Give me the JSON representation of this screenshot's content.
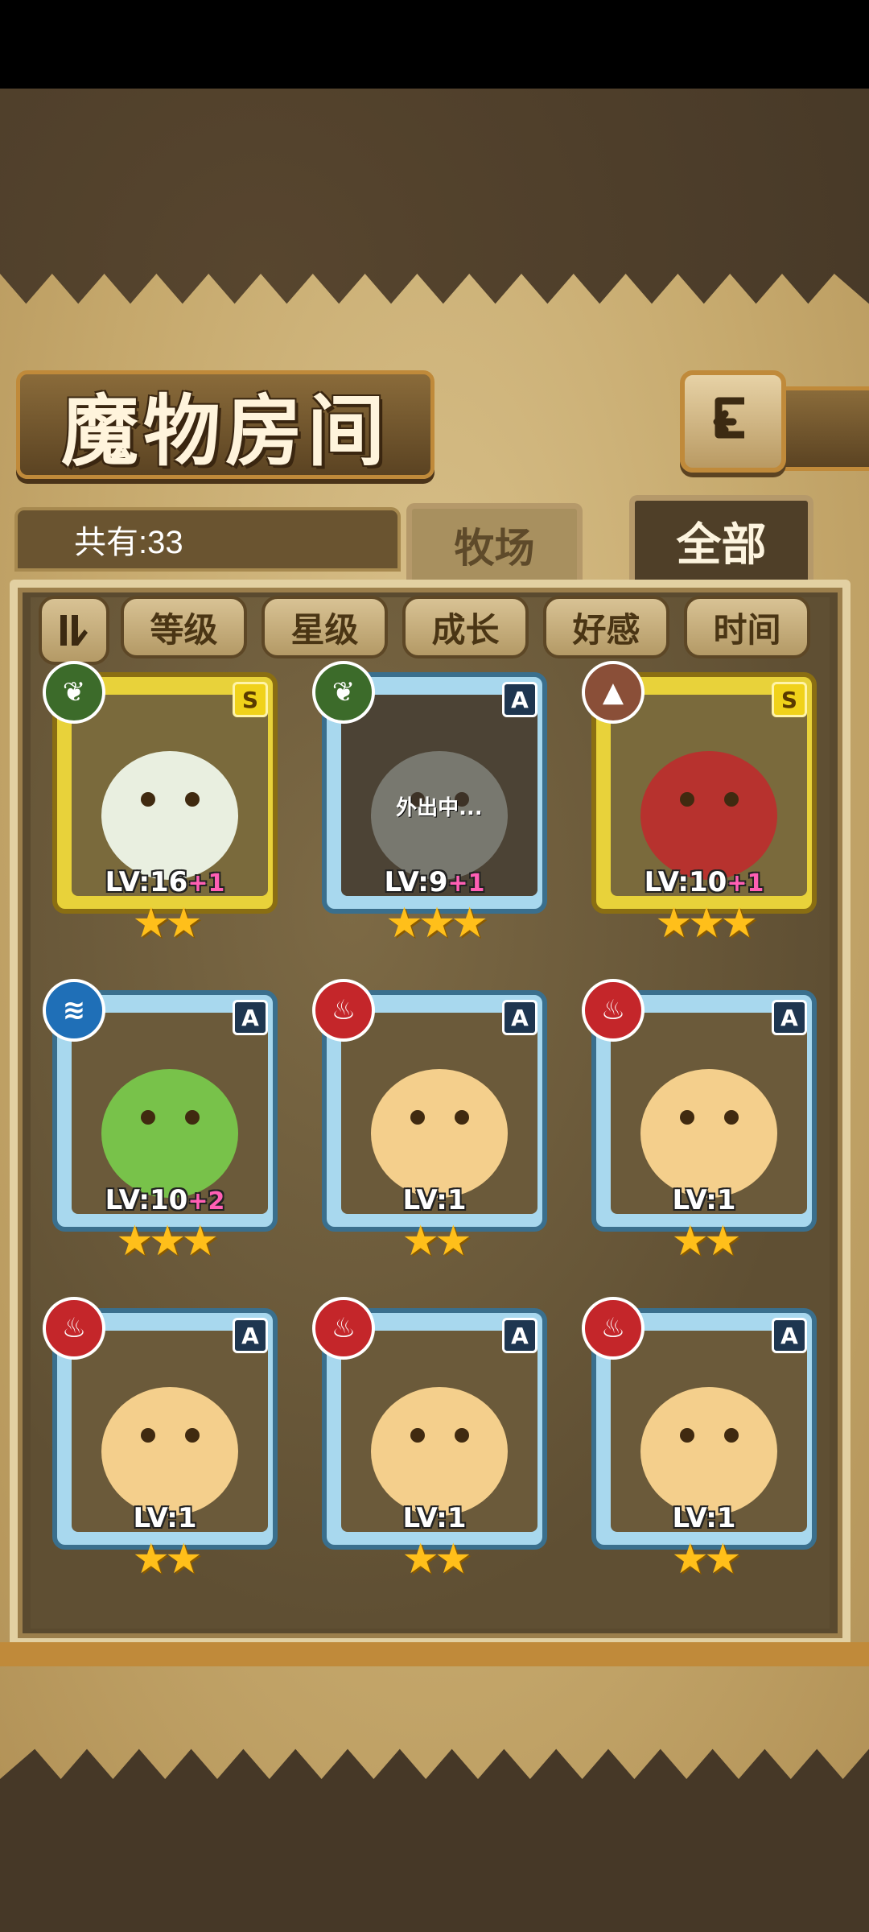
{
  "header": {
    "title": "魔物房间",
    "back_icon": "return-arrow-icon"
  },
  "summary": {
    "count_label": "共有:33"
  },
  "tabs": [
    {
      "label": "牧场",
      "selected": false
    },
    {
      "label": "全部",
      "selected": true
    }
  ],
  "sort": {
    "toggle_icon": "sort-order-icon",
    "buttons": [
      "等级",
      "星级",
      "成长",
      "好感",
      "时间"
    ]
  },
  "cards": [
    {
      "rank": "S",
      "element": "leaf",
      "frame": "gold",
      "level": "LV:16",
      "bonus": "+1",
      "stars": 2,
      "status": ""
    },
    {
      "rank": "A",
      "element": "leaf",
      "frame": "blue",
      "level": "LV:9",
      "bonus": "+1",
      "stars": 3,
      "status": "外出中..."
    },
    {
      "rank": "S",
      "element": "earth",
      "frame": "gold",
      "level": "LV:10",
      "bonus": "+1",
      "stars": 3,
      "status": ""
    },
    {
      "rank": "A",
      "element": "water",
      "frame": "blue",
      "level": "LV:10",
      "bonus": "+2",
      "stars": 3,
      "status": ""
    },
    {
      "rank": "A",
      "element": "fire",
      "frame": "blue",
      "level": "LV:1",
      "bonus": "",
      "stars": 2,
      "status": ""
    },
    {
      "rank": "A",
      "element": "fire",
      "frame": "blue",
      "level": "LV:1",
      "bonus": "",
      "stars": 2,
      "status": ""
    },
    {
      "rank": "A",
      "element": "fire",
      "frame": "blue",
      "level": "LV:1",
      "bonus": "",
      "stars": 2,
      "status": ""
    },
    {
      "rank": "A",
      "element": "fire",
      "frame": "blue",
      "level": "LV:1",
      "bonus": "",
      "stars": 2,
      "status": ""
    },
    {
      "rank": "A",
      "element": "fire",
      "frame": "blue",
      "level": "LV:1",
      "bonus": "",
      "stars": 2,
      "status": ""
    }
  ],
  "colors": {
    "gold_frame": "#e8d23a",
    "blue_frame": "#a8d8ee",
    "level_bonus": "#ff5fb4",
    "fire": "#c4262a",
    "leaf": "#3c6b2a",
    "water": "#1f6fb7",
    "earth": "#8a4f38"
  }
}
